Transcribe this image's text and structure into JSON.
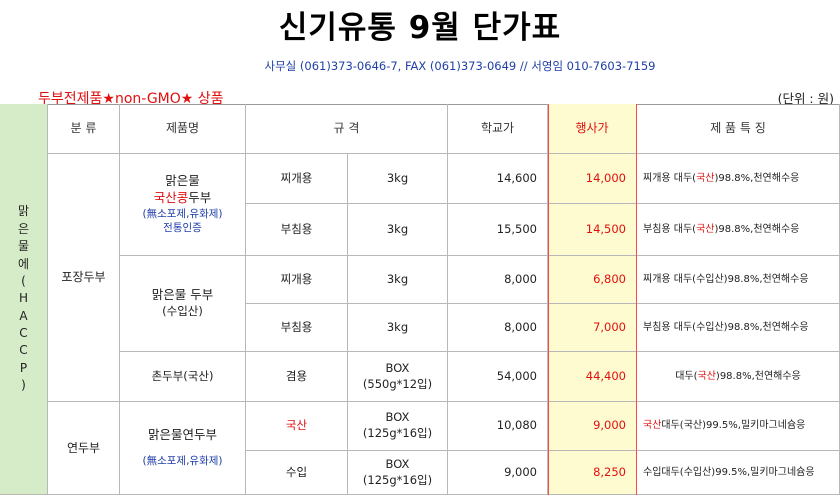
{
  "title": "신기유통  9월 단가표",
  "contact": "사무실 (061)373-0646-7, FAX (061)373-0649  //  서영임 010-7603-7159",
  "subtitle_left": "두부전제품★non-GMO★ 상품",
  "unit": "(단위 : 원)",
  "header": {
    "category": "분 류",
    "product": "제품명",
    "spec": "규   격",
    "school_price": "학교가",
    "event_price": "행사가",
    "features": "제  품  특  징"
  },
  "side_label_chars": [
    "맑",
    "은",
    "물",
    "에",
    "(",
    "H",
    "A",
    "C",
    "C",
    "P",
    ")"
  ],
  "groups": {
    "g1": "포장두부",
    "g2": "연두부"
  },
  "products": {
    "p1": {
      "line1": "맑은물",
      "line2": "국산콩두부",
      "line3": "(無소포제,유화제)",
      "line4": "전통인증"
    },
    "p2": {
      "line1": "맑은물 두부",
      "line2": "(수입산)"
    },
    "p3": {
      "line1": "촌두부(국산)"
    },
    "p4": {
      "line1": "맑은물연두부",
      "line2": "(無소포제,유화제)"
    }
  },
  "rows": [
    {
      "type": "찌개용",
      "size": "3kg",
      "school": "14,600",
      "event": "14,000",
      "feat_pre": "찌개용 대두(",
      "feat_red": "국산",
      "feat_post": ")98.8%,천연해수응"
    },
    {
      "type": "부침용",
      "size": "3kg",
      "school": "15,500",
      "event": "14,500",
      "feat_pre": "부침용 대두(",
      "feat_red": "국산",
      "feat_post": ")98.8%,천연해수응"
    },
    {
      "type": "찌개용",
      "size": "3kg",
      "school": "8,000",
      "event": "6,800",
      "feat_pre": "찌개용 대두(수입산)98.8%,천연해수응",
      "feat_red": "",
      "feat_post": ""
    },
    {
      "type": "부침용",
      "size": "3kg",
      "school": "8,000",
      "event": "7,000",
      "feat_pre": "부침용 대두(수입산)98.8%,천연해수응",
      "feat_red": "",
      "feat_post": ""
    },
    {
      "type": "겸용",
      "size1": "BOX",
      "size2": "(550g*12입)",
      "school": "54,000",
      "event": "44,400",
      "feat_pre": "대두(",
      "feat_red": "국산",
      "feat_post": ")98.8%,천연해수응"
    },
    {
      "type": "국산",
      "size1": "BOX",
      "size2": "(125g*16입)",
      "school": "10,080",
      "event": "9,000",
      "feat_pre": "",
      "feat_red": "국산",
      "feat_post": "대두(국산)99.5%,밀키마그네슘응"
    },
    {
      "type": "수입",
      "size1": "BOX",
      "size2": "(125g*16입)",
      "school": "9,000",
      "event": "8,250",
      "feat_pre": "수입대두(수입산)99.5%,밀키마그네슘응",
      "feat_red": "",
      "feat_post": ""
    }
  ]
}
